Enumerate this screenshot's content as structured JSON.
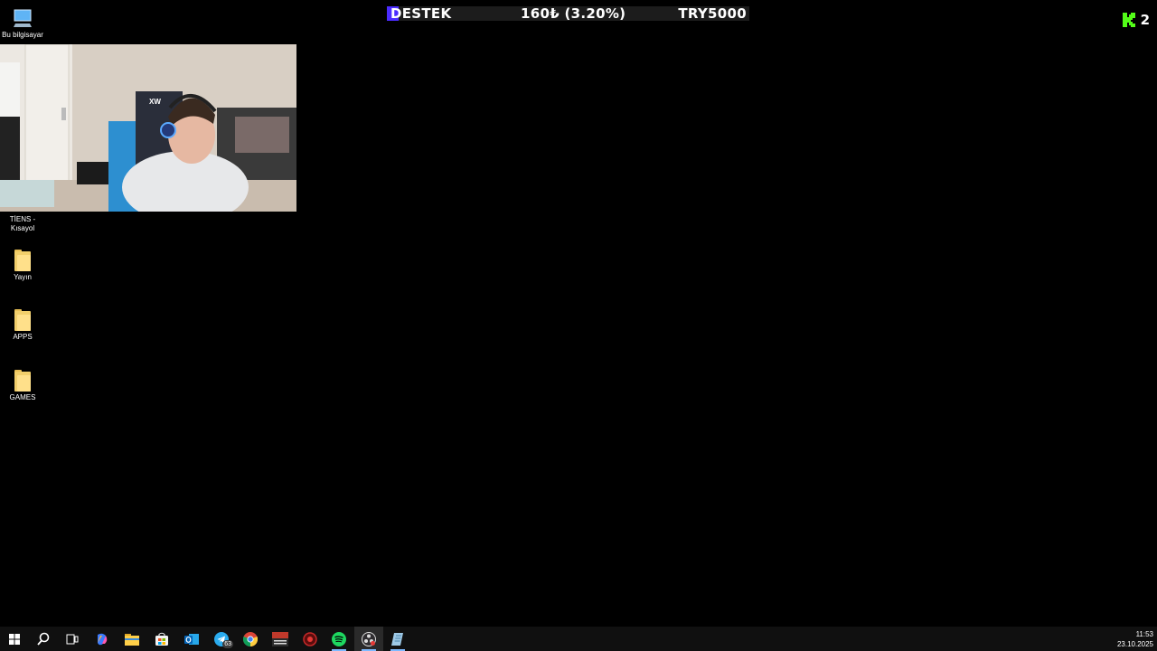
{
  "desktop": {
    "icons": [
      {
        "label": "Bu bilgisayar",
        "icon": "computer-icon"
      },
      {
        "label": "TİENS - Kısayol",
        "icon": "shortcut-icon"
      },
      {
        "label": "Yayın",
        "icon": "folder-icon"
      },
      {
        "label": "APPS",
        "icon": "folder-icon"
      },
      {
        "label": "GAMES",
        "icon": "folder-icon"
      }
    ]
  },
  "donation_bar": {
    "label": "DESTEK",
    "amount_text": "160₺ (3.20%)",
    "goal_text": "TRY5000",
    "progress_percent": 3.2,
    "fill_color": "#4b2cff"
  },
  "kick": {
    "logo": "kick-logo-icon",
    "viewer_count": "2",
    "accent": "#53fc18"
  },
  "webcam": {
    "content": "webcam-overlay"
  },
  "taskbar": {
    "items": [
      {
        "icon": "windows-start-icon"
      },
      {
        "icon": "search-icon"
      },
      {
        "icon": "task-view-icon"
      },
      {
        "icon": "copilot-icon"
      },
      {
        "icon": "file-explorer-icon"
      },
      {
        "icon": "microsoft-store-icon"
      },
      {
        "icon": "outlook-icon"
      },
      {
        "icon": "telegram-icon",
        "badge": "63"
      },
      {
        "icon": "chrome-icon"
      },
      {
        "icon": "voicemeeter-icon"
      },
      {
        "icon": "game-launcher-icon"
      },
      {
        "icon": "spotify-icon"
      },
      {
        "icon": "obs-icon"
      },
      {
        "icon": "notepad-icon"
      }
    ],
    "clock": {
      "time": "11:53",
      "date": "23.10.2025"
    }
  }
}
